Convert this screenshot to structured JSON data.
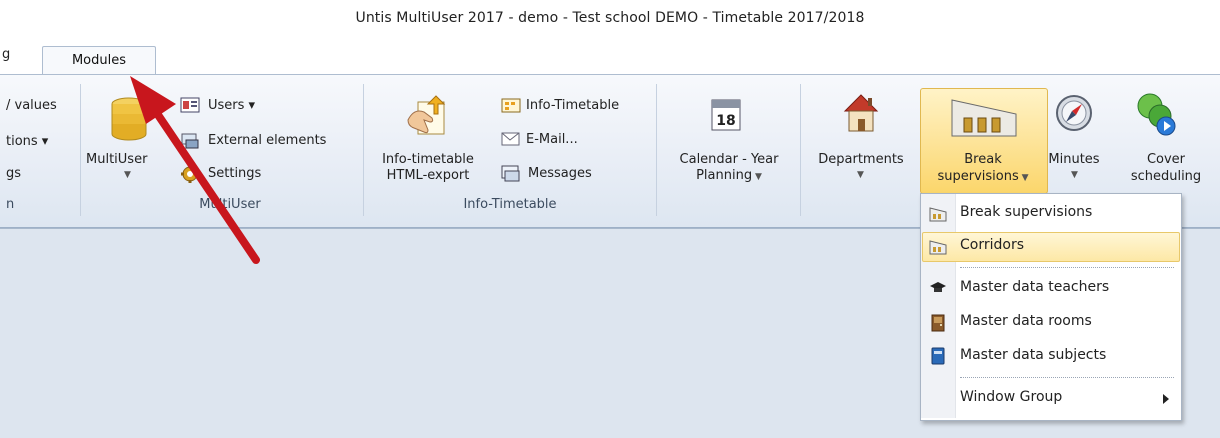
{
  "window": {
    "title": "Untis MultiUser 2017 - demo  -  Test school  DEMO  -  Timetable 2017/2018"
  },
  "tabs": {
    "partial_left": "g",
    "active": "Modules"
  },
  "left_partial": {
    "row1": "/ values",
    "row2": "tions ▾",
    "row3": "gs",
    "row4": "n"
  },
  "multiuser_group": {
    "multiuser_label": "MultiUser",
    "users_label": "Users ▾",
    "external_label": "External elements",
    "settings_label": "Settings",
    "group_label": "MultiUser"
  },
  "infotimetable_group": {
    "html_export_line1": "Info-timetable",
    "html_export_line2": "HTML-export",
    "info_timetable_label": "Info-Timetable",
    "email_label": "E-Mail...",
    "messages_label": "Messages",
    "group_label": "Info-Timetable"
  },
  "calendar": {
    "line1": "Calendar - Year",
    "line2": "Planning",
    "icon_day": "18"
  },
  "departments": {
    "label": "Departments"
  },
  "break_supervisions": {
    "line1": "Break",
    "line2": "supervisions"
  },
  "minutes": {
    "label": "Minutes"
  },
  "cover": {
    "line1": "Cover",
    "line2": "scheduling"
  },
  "dropdown": {
    "items": [
      {
        "label": "Break supervisions",
        "icon": "break-supervision-icon"
      },
      {
        "label": "Corridors",
        "icon": "corridor-icon",
        "selected": true
      },
      {
        "label": "Master data teachers",
        "icon": "mortarboard-icon"
      },
      {
        "label": "Master data rooms",
        "icon": "door-icon"
      },
      {
        "label": "Master data subjects",
        "icon": "book-icon"
      },
      {
        "label": "Window Group",
        "icon": "submenu-arrow-icon"
      }
    ]
  },
  "colors": {
    "accent_highlight": "#fde49a",
    "arrow": "#c8161d",
    "workspace": "#dde5ef"
  }
}
